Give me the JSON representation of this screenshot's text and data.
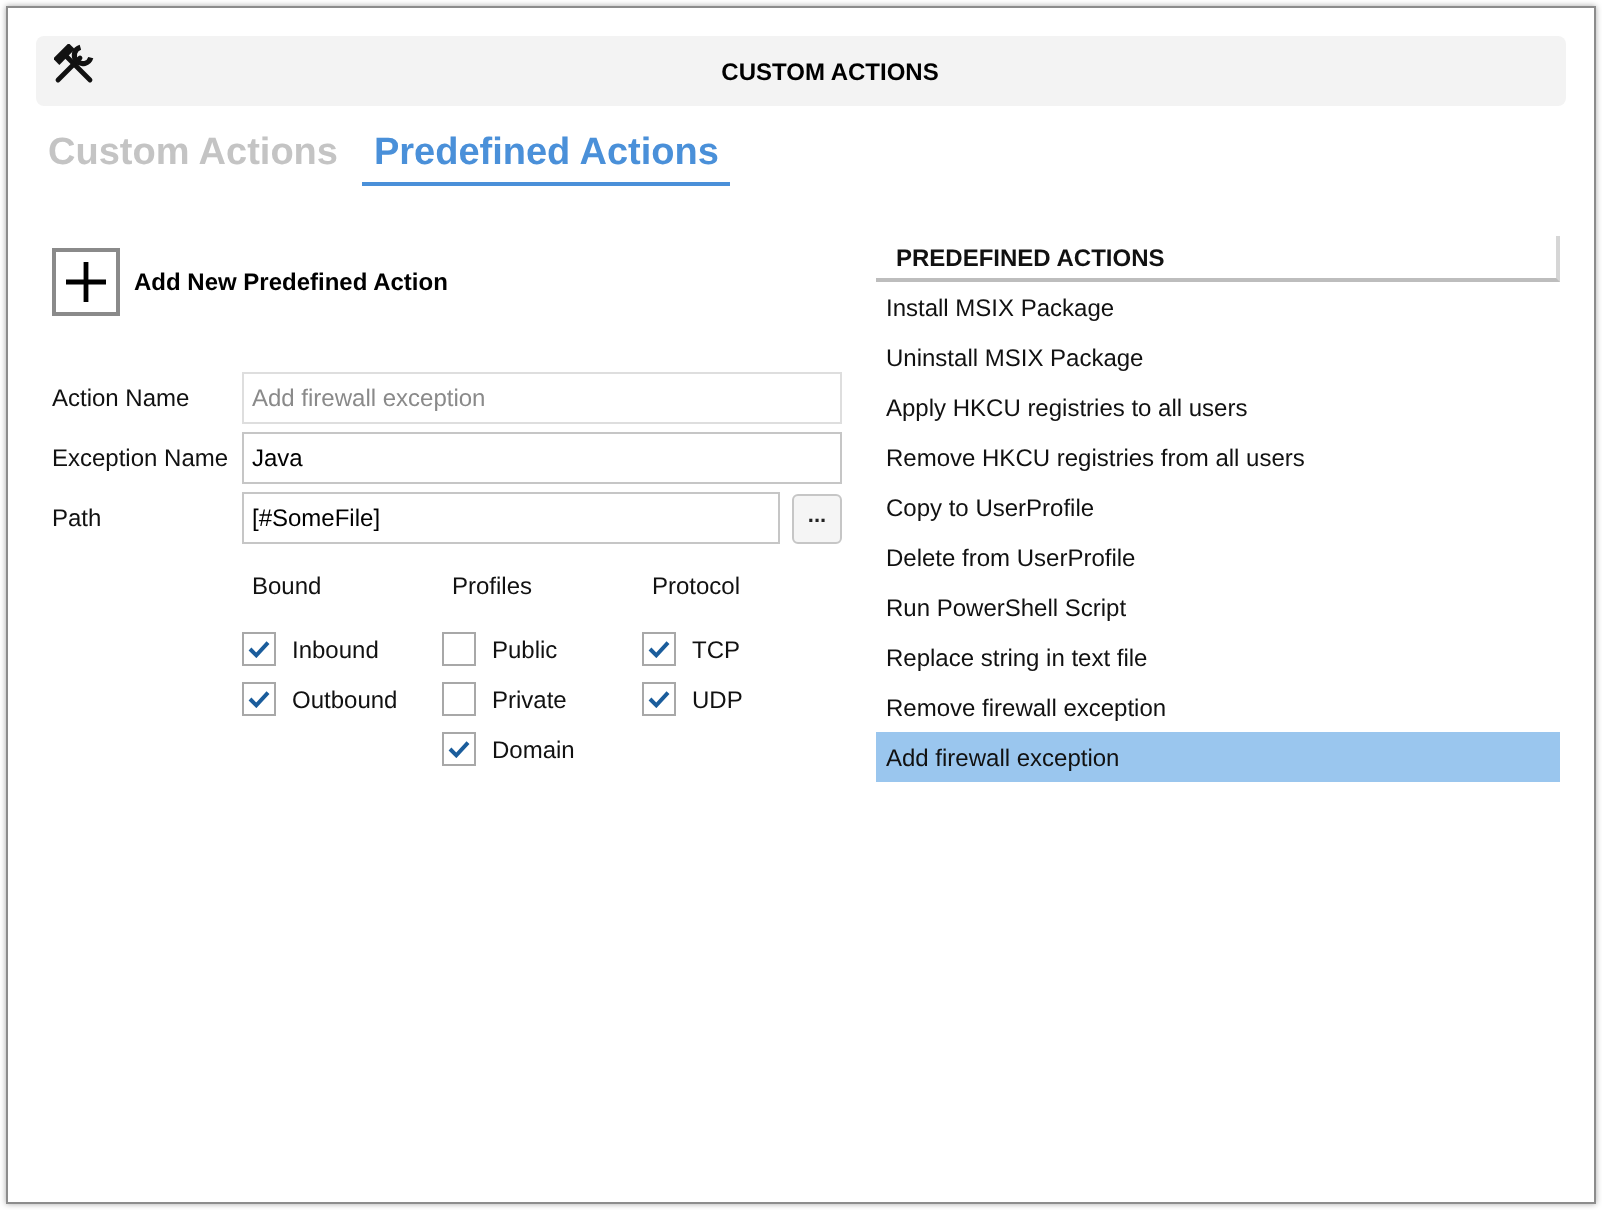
{
  "window": {
    "title": "CUSTOM ACTIONS"
  },
  "tabs": [
    {
      "label": "Custom Actions",
      "selected": false
    },
    {
      "label": "Predefined Actions",
      "selected": true
    }
  ],
  "add_button": {
    "label": "Add New Predefined Action"
  },
  "fields": [
    {
      "label": "Action Name",
      "placeholder": "Add firewall exception"
    },
    {
      "label": "Exception Name",
      "value": "Java"
    },
    {
      "label": "Path",
      "value": "[#SomeFile]",
      "browse_button": "..."
    }
  ],
  "checkbox_groups": [
    {
      "title": "Bound",
      "options": [
        {
          "label": "Inbound",
          "checked": true
        },
        {
          "label": "Outbound",
          "checked": true
        }
      ]
    },
    {
      "title": "Profiles",
      "options": [
        {
          "label": "Public",
          "checked": false
        },
        {
          "label": "Private",
          "checked": false
        },
        {
          "label": "Domain",
          "checked": true
        }
      ]
    },
    {
      "title": "Protocol",
      "options": [
        {
          "label": "TCP",
          "checked": true
        },
        {
          "label": "UDP",
          "checked": true
        }
      ]
    }
  ],
  "predefined_actions": {
    "header": "PREDEFINED ACTIONS",
    "items": [
      {
        "label": "Install MSIX Package",
        "selected": false
      },
      {
        "label": "Uninstall MSIX Package",
        "selected": false
      },
      {
        "label": "Apply HKCU registries to all users",
        "selected": false
      },
      {
        "label": "Remove HKCU registries from all users",
        "selected": false
      },
      {
        "label": "Copy to UserProfile",
        "selected": false
      },
      {
        "label": "Delete from UserProfile",
        "selected": false
      },
      {
        "label": "Run PowerShell Script",
        "selected": false
      },
      {
        "label": "Replace string in text file",
        "selected": false
      },
      {
        "label": "Remove firewall exception",
        "selected": false
      },
      {
        "label": "Add firewall exception",
        "selected": true
      }
    ]
  }
}
